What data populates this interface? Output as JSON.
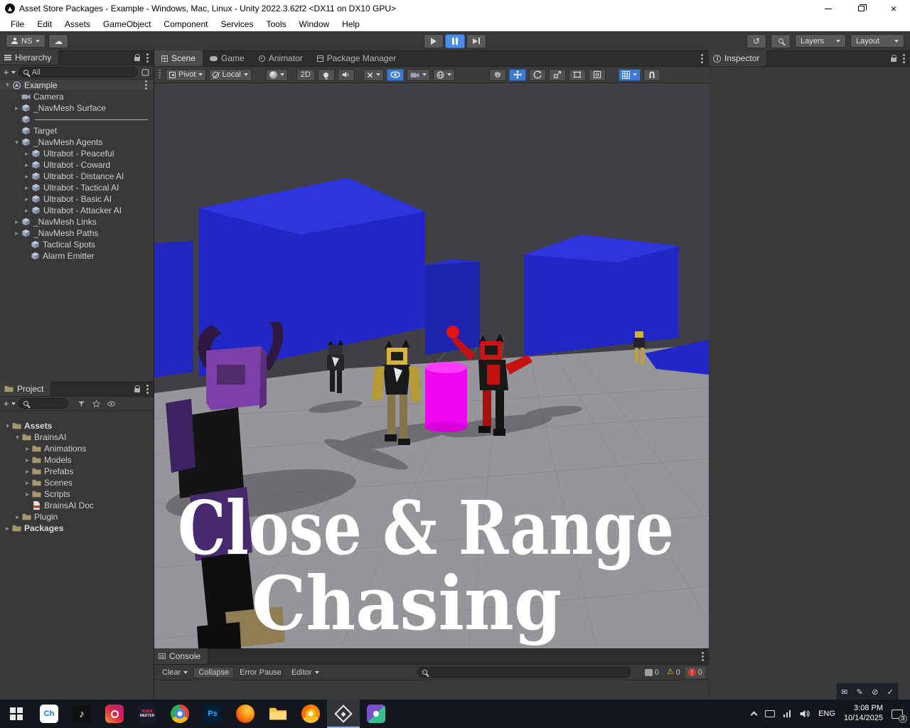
{
  "window": {
    "title": "Asset Store Packages - Example - Windows, Mac, Linux - Unity 2022.3.62f2 <DX11 on DX10 GPU>"
  },
  "menu": {
    "items": [
      "File",
      "Edit",
      "Assets",
      "GameObject",
      "Component",
      "Services",
      "Tools",
      "Window",
      "Help"
    ]
  },
  "toolbar": {
    "account_label": "NS",
    "layers_label": "Layers",
    "layout_label": "Layout"
  },
  "tabs": {
    "scene": "Scene",
    "game": "Game",
    "animator": "Animator",
    "package_manager": "Package Manager"
  },
  "scene_toolbar": {
    "pivot": "Pivot",
    "local": "Local",
    "two_d": "2D"
  },
  "hierarchy": {
    "title": "Hierarchy",
    "search_value": "All",
    "scene_arrow": "▾",
    "scene_name": "Example",
    "items": [
      {
        "arrow": "",
        "label": "Camera"
      },
      {
        "arrow": "▸",
        "label": "_NavMesh Surface"
      },
      {
        "arrow": "",
        "label": ""
      },
      {
        "arrow": "",
        "label": "Target"
      },
      {
        "arrow": "▾",
        "label": "_NavMesh Agents"
      },
      {
        "arrow": "▸",
        "label": "Ultrabot - Peaceful"
      },
      {
        "arrow": "▸",
        "label": "Ultrabot - Coward"
      },
      {
        "arrow": "▸",
        "label": "Ultrabot - Distance AI"
      },
      {
        "arrow": "▸",
        "label": "Ultrabot - Tactical AI"
      },
      {
        "arrow": "▸",
        "label": "Ultrabot - Basic AI"
      },
      {
        "arrow": "▸",
        "label": "Ultrabot - Attacker AI"
      },
      {
        "arrow": "▸",
        "label": "_NavMesh Links"
      },
      {
        "arrow": "▸",
        "label": "_NavMesh Paths"
      },
      {
        "arrow": "",
        "label": "Tactical Spots"
      },
      {
        "arrow": "",
        "label": "Alarm Emitter"
      }
    ]
  },
  "project": {
    "title": "Project",
    "items": [
      {
        "arrow": "▾",
        "label": "Assets"
      },
      {
        "arrow": "▾",
        "label": "BrainsAI"
      },
      {
        "arrow": "▸",
        "label": "Animations"
      },
      {
        "arrow": "▸",
        "label": "Models"
      },
      {
        "arrow": "▸",
        "label": "Prefabs"
      },
      {
        "arrow": "▸",
        "label": "Scenes"
      },
      {
        "arrow": "▸",
        "label": "Scripts"
      },
      {
        "arrow": "",
        "label": "BrainsAI Doc"
      },
      {
        "arrow": "▸",
        "label": "Plugin"
      },
      {
        "arrow": "▸",
        "label": "Packages"
      }
    ]
  },
  "viewport": {
    "caption_line1": "Close & Range",
    "caption_line2": "Chasing"
  },
  "console": {
    "title": "Console",
    "clear_label": "Clear",
    "collapse_label": "Collapse",
    "error_pause_label": "Error Pause",
    "editor_label": "Editor",
    "info_count": "0",
    "warning_count": "0",
    "error_count": "0"
  },
  "inspector": {
    "title": "Inspector"
  },
  "taskbar": {
    "apps": {
      "ch_badge": "Ch",
      "ps_badge": "Ps",
      "vm_line1": "VOICE",
      "vm_line2": "MEETER"
    },
    "tray": {
      "lang": "ENG",
      "time": "3:08 PM",
      "date": "10/14/2025",
      "notif_count": "3"
    }
  },
  "icons": {
    "cloud": "☁",
    "history": "↺",
    "warning": "⚠",
    "music_note": "♪",
    "close": "×",
    "plus": "+",
    "tray_overflow": [
      "✉",
      "✎",
      "⊘",
      "✓"
    ]
  }
}
